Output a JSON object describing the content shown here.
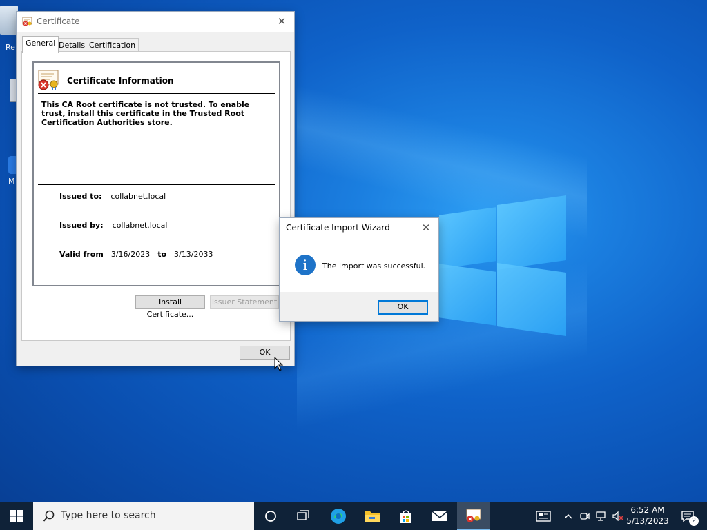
{
  "desktop": {
    "icon_labels": [
      "Re",
      "M"
    ]
  },
  "certificate_window": {
    "title": "Certificate",
    "close_glyph": "✕",
    "tabs": [
      {
        "label": "General",
        "active": true
      },
      {
        "label": "Details",
        "active": false
      },
      {
        "label": "Certification Path",
        "active": false
      }
    ],
    "info_title": "Certificate Information",
    "warning": "This CA Root certificate is not trusted. To enable trust, install this certificate in the Trusted Root Certification Authorities store.",
    "issued_to_label": "Issued to:",
    "issued_to": "collabnet.local",
    "issued_by_label": "Issued by:",
    "issued_by": "collabnet.local",
    "valid_from_label": "Valid from",
    "valid_from": "3/16/2023",
    "valid_to_label": "to",
    "valid_to": "3/13/2033",
    "install_button": "Install Certificate...",
    "issuer_statement_button": "Issuer Statement",
    "ok_button": "OK"
  },
  "import_wizard": {
    "title": "Certificate Import Wizard",
    "close_glyph": "✕",
    "message": "The import was successful.",
    "info_glyph": "i",
    "ok_button": "OK"
  },
  "taskbar": {
    "search_placeholder": "Type here to search",
    "time": "6:52 AM",
    "date": "5/13/2023",
    "notification_count": "2",
    "icons": [
      "windows-start-icon",
      "search-icon",
      "cortana-icon",
      "task-view-icon",
      "edge-icon",
      "file-explorer-icon",
      "store-icon",
      "mail-icon",
      "certificate-app-icon",
      "news-icon",
      "chevron-up-icon",
      "meet-now-icon",
      "network-icon",
      "volume-muted-icon",
      "notification-center-icon"
    ]
  },
  "colors": {
    "accent": "#0078d7",
    "taskbar": "#0f2238",
    "info_icon": "#1e73c8"
  }
}
